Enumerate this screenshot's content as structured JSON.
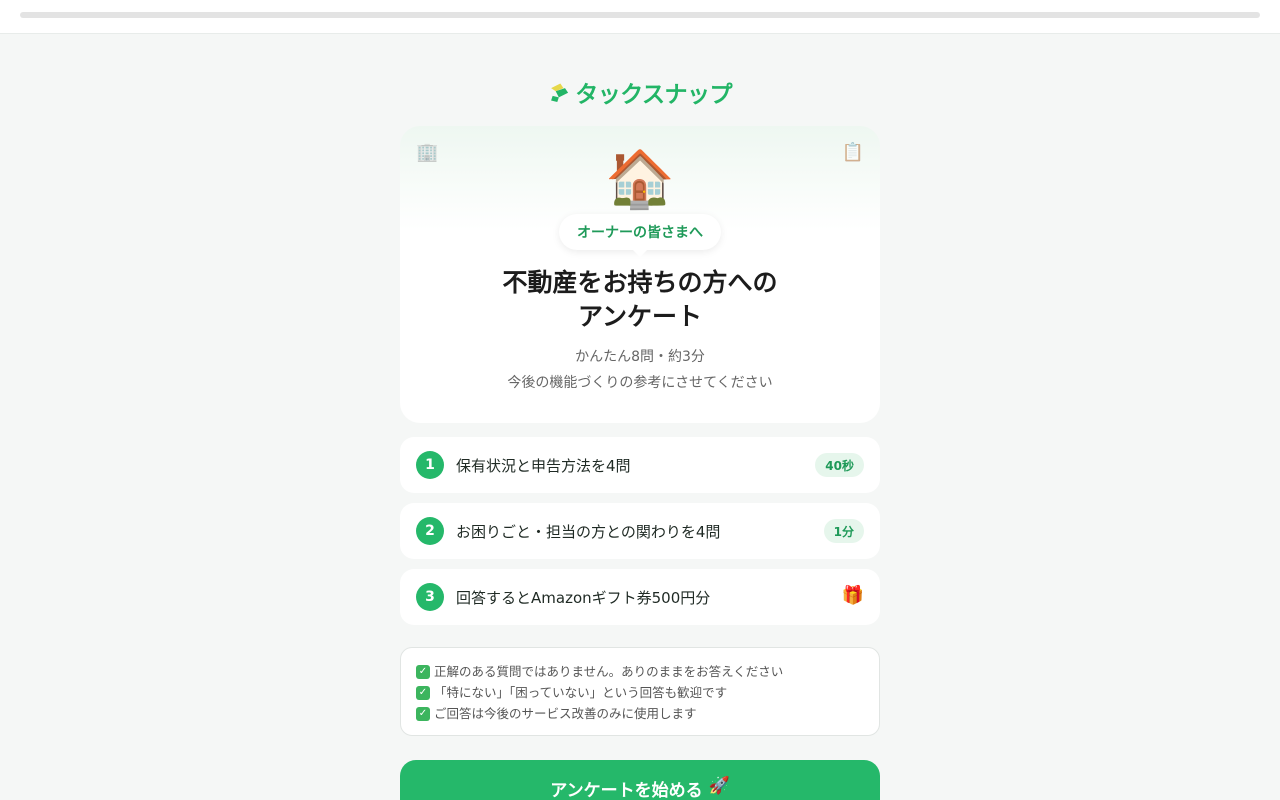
{
  "progress": {
    "fraction": 0.0
  },
  "brand": {
    "name": "タックスナップ",
    "icon": "taxsnap-logo-mark",
    "color": "#22b566"
  },
  "hero": {
    "left_icon": "🏢",
    "right_icon": "📋",
    "illustration": "🏠",
    "pill": "オーナーの皆さまへ",
    "title_line1": "不動産をお持ちの方への",
    "title_line2": "アンケート",
    "subtitle1": "かんたん8問・約3分",
    "subtitle2": "今後の機能づくりの参考にさせてください"
  },
  "steps": [
    {
      "num": "1",
      "label": "保有状況と申告方法を4問",
      "badge": "40秒"
    },
    {
      "num": "2",
      "label": "お困りごと・担当の方との関わりを4問",
      "badge": "1分"
    },
    {
      "num": "3",
      "label": "回答するとAmazonギフト券500円分",
      "icon": "🎁"
    }
  ],
  "notes": [
    "正解のある質問ではありません。ありのままをお答えください",
    "「特にない」「困っていない」という回答も歓迎です",
    "ご回答は今後のサービス改善のみに使用します"
  ],
  "start_button": {
    "label": "アンケートを始める",
    "icon": "🚀"
  },
  "colors": {
    "accent": "#25b86a",
    "background": "#f5f7f6"
  }
}
